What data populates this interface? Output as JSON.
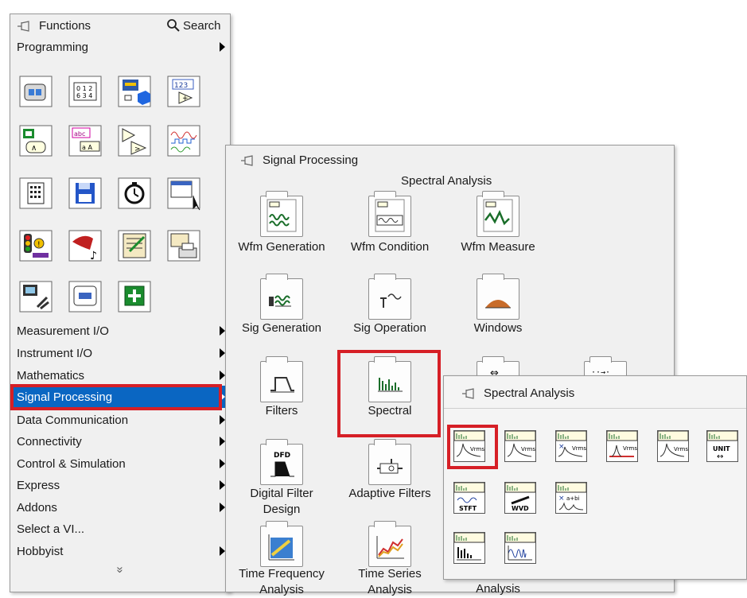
{
  "functions_palette": {
    "title": "Functions",
    "search_label": "Search",
    "programming_label": "Programming",
    "categories": [
      {
        "label": "Measurement I/O",
        "has_arrow": true
      },
      {
        "label": "Instrument I/O",
        "has_arrow": true
      },
      {
        "label": "Mathematics",
        "has_arrow": true
      },
      {
        "label": "Signal Processing",
        "has_arrow": true,
        "selected": true
      },
      {
        "label": "Data Communication",
        "has_arrow": true
      },
      {
        "label": "Connectivity",
        "has_arrow": true
      },
      {
        "label": "Control & Simulation",
        "has_arrow": true
      },
      {
        "label": "Express",
        "has_arrow": true
      },
      {
        "label": "Addons",
        "has_arrow": true
      },
      {
        "label": "Select a VI...",
        "has_arrow": false
      },
      {
        "label": "Hobbyist",
        "has_arrow": true
      }
    ],
    "expand_glyph": "»"
  },
  "signal_processing_palette": {
    "title": "Signal Processing",
    "tooltip": "Spectral Analysis",
    "folders": [
      {
        "label": "Wfm Generation"
      },
      {
        "label": "Wfm Condition"
      },
      {
        "label": "Wfm Measure"
      },
      {
        "label": "Sig Generation"
      },
      {
        "label": "Sig Operation"
      },
      {
        "label": "Windows"
      },
      {
        "label": "Filters"
      },
      {
        "label": "Spectral",
        "selected": true
      },
      {
        "label": "Digital Filter\nDesign"
      },
      {
        "label": "Adaptive Filters"
      },
      {
        "label": "Time Frequency\nAnalysis"
      },
      {
        "label": "Time Series\nAnalysis"
      },
      {
        "label": "Analysis"
      }
    ]
  },
  "spectral_analysis_palette": {
    "title": "Spectral Analysis",
    "row1_tags": [
      "Vrms",
      "Vrms",
      "Vrms",
      "Vrms",
      "Vrms",
      "UNIT"
    ],
    "row2_tags": [
      "STFT",
      "WVD",
      "a+bi"
    ],
    "selected_index": 0
  },
  "colors": {
    "highlight_red": "#d61f26",
    "selection_blue": "#0a66c2",
    "palette_bg": "#f0f0f0"
  }
}
